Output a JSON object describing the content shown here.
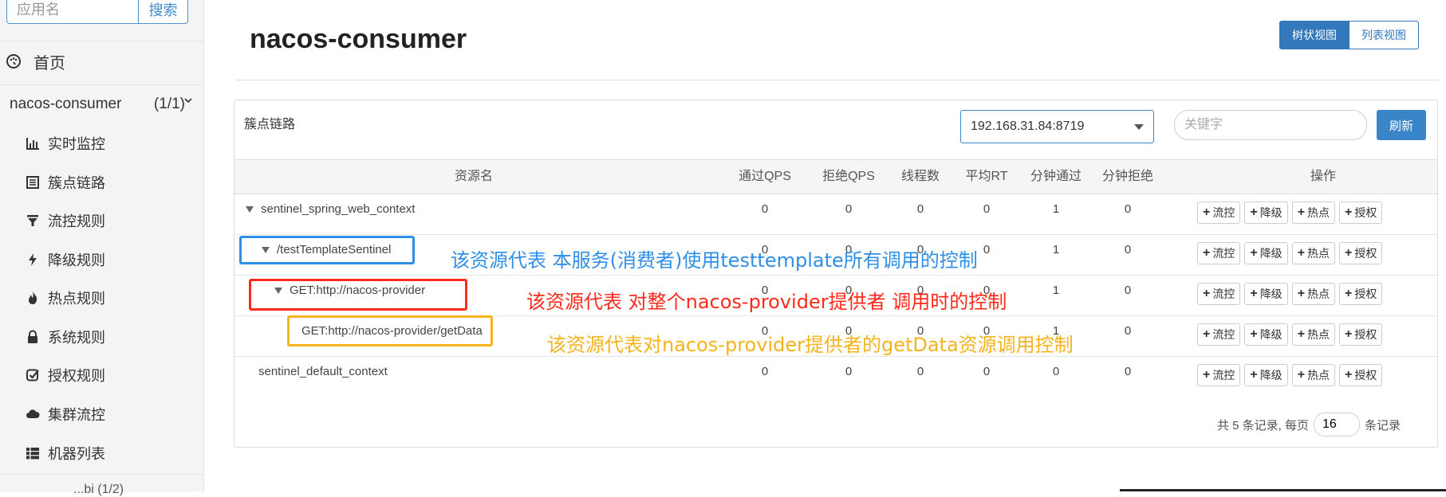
{
  "sidebar": {
    "search": {
      "placeholder": "应用名",
      "button_label": "搜索"
    },
    "home_label": "首页",
    "app": {
      "name": "nacos-consumer",
      "count": "(1/1)"
    },
    "menu": [
      {
        "label": "实时监控",
        "icon": "bar-chart-icon"
      },
      {
        "label": "簇点链路",
        "icon": "list-icon"
      },
      {
        "label": "流控规则",
        "icon": "filter-icon"
      },
      {
        "label": "降级规则",
        "icon": "lightning-icon"
      },
      {
        "label": "热点规则",
        "icon": "fire-icon"
      },
      {
        "label": "系统规则",
        "icon": "lock-icon"
      },
      {
        "label": "授权规则",
        "icon": "check-square-icon"
      },
      {
        "label": "集群流控",
        "icon": "cloud-icon"
      },
      {
        "label": "机器列表",
        "icon": "table-list-icon"
      }
    ],
    "next_app_partial": "...bi   (1/2)"
  },
  "main": {
    "title": "nacos-consumer",
    "view_toggle": {
      "tree": "树状视图",
      "list": "列表视图"
    },
    "panel_title": "簇点链路",
    "machine": "192.168.31.84:8719",
    "keyword_placeholder": "关键字",
    "refresh_label": "刷新",
    "columns": [
      "资源名",
      "通过QPS",
      "拒绝QPS",
      "线程数",
      "平均RT",
      "分钟通过",
      "分钟拒绝",
      "操作"
    ],
    "rows": [
      {
        "name": "sentinel_spring_web_context",
        "pass_qps": "0",
        "block_qps": "0",
        "threads": "0",
        "avg_rt": "0",
        "min_pass": "1",
        "min_block": "0"
      },
      {
        "name": "/testTemplateSentinel",
        "pass_qps": "0",
        "block_qps": "0",
        "threads": "0",
        "avg_rt": "0",
        "min_pass": "1",
        "min_block": "0"
      },
      {
        "name": "GET:http://nacos-provider",
        "pass_qps": "0",
        "block_qps": "0",
        "threads": "0",
        "avg_rt": "0",
        "min_pass": "1",
        "min_block": "0"
      },
      {
        "name": "GET:http://nacos-provider/getData",
        "pass_qps": "0",
        "block_qps": "0",
        "threads": "0",
        "avg_rt": "0",
        "min_pass": "1",
        "min_block": "0"
      },
      {
        "name": "sentinel_default_context",
        "pass_qps": "0",
        "block_qps": "0",
        "threads": "0",
        "avg_rt": "0",
        "min_pass": "0",
        "min_block": "0"
      }
    ],
    "ops": [
      "流控",
      "降级",
      "热点",
      "授权"
    ],
    "pager": {
      "prefix": "共 5 条记录, 每页",
      "page_size": "16",
      "suffix": "条记录"
    }
  },
  "annotations": [
    {
      "text": "该资源代表 本服务(消费者)使用testtemplate所有调用的控制",
      "color": "#2f8fe6"
    },
    {
      "text": "该资源代表 对整个nacos-provider提供者 调用时的控制",
      "color": "#ff2a1a"
    },
    {
      "text": "该资源代表对nacos-provider提供者的getData资源调用控制",
      "color": "#f5b31c"
    }
  ],
  "colors": {
    "accent": "#3478bc",
    "blue_box": "#2f8fe6",
    "red_box": "#ff2a1a",
    "yellow_box": "#f5b31c"
  }
}
